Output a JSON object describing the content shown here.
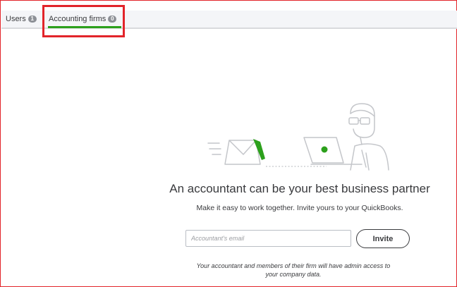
{
  "tabs": [
    {
      "label": "Users",
      "count": "1"
    },
    {
      "label": "Accounting firms",
      "count": "0"
    }
  ],
  "active_tab": "Accounting firms",
  "empty_state": {
    "headline": "An accountant can be your best business partner",
    "subline": "Make it easy to work together. Invite yours to your QuickBooks.",
    "note": "Your accountant and members of their firm will have admin access to your company data."
  },
  "form": {
    "email_placeholder": "Accountant's email",
    "email_value": "",
    "invite_label": "Invite"
  },
  "colors": {
    "accent_green": "#2ca01c",
    "highlight_red": "#e2242a",
    "text": "#393a3d"
  },
  "icons": [
    "envelope-icon",
    "laptop-icon",
    "accountant-figure-icon"
  ]
}
